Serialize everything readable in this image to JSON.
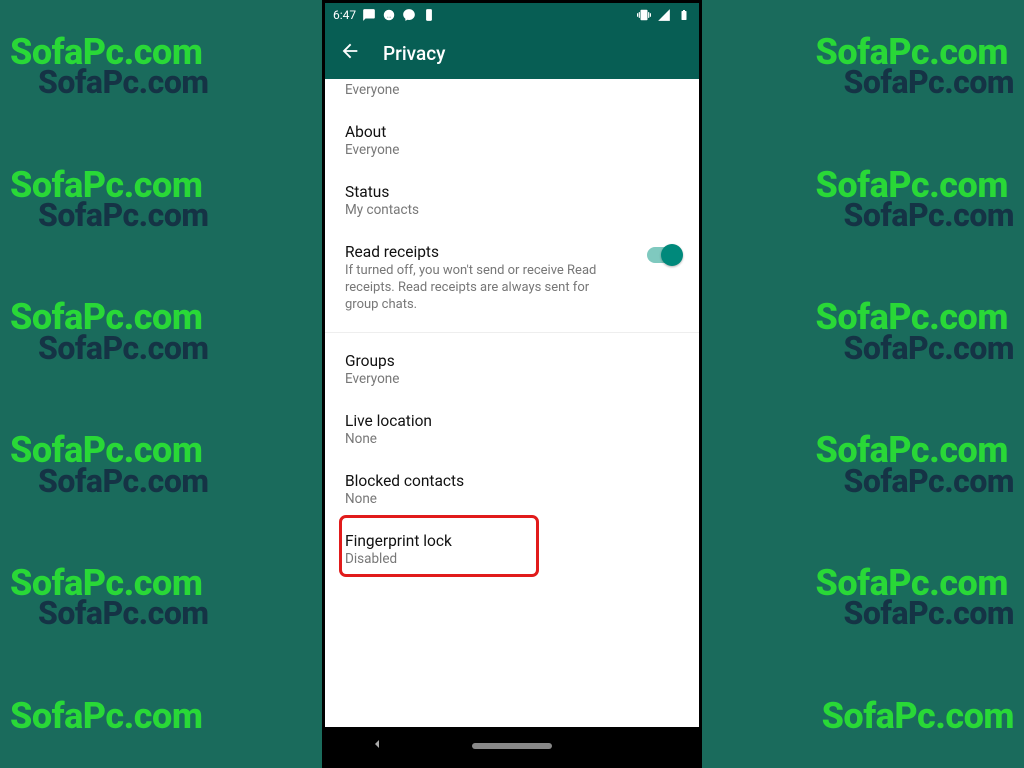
{
  "watermark": {
    "primary": "SofaPc.com",
    "shadow": "SofaPc.com",
    "partial": "m"
  },
  "statusBar": {
    "time": "6:47"
  },
  "appBar": {
    "title": "Privacy"
  },
  "settings": {
    "partial": {
      "sub": "Everyone"
    },
    "about": {
      "title": "About",
      "sub": "Everyone"
    },
    "status": {
      "title": "Status",
      "sub": "My contacts"
    },
    "readReceipts": {
      "title": "Read receipts",
      "desc": "If turned off, you won't send or receive Read receipts. Read receipts are always sent for group chats.",
      "enabled": true
    },
    "groups": {
      "title": "Groups",
      "sub": "Everyone"
    },
    "liveLocation": {
      "title": "Live location",
      "sub": "None"
    },
    "blocked": {
      "title": "Blocked contacts",
      "sub": "None"
    },
    "fingerprint": {
      "title": "Fingerprint lock",
      "sub": "Disabled"
    }
  }
}
